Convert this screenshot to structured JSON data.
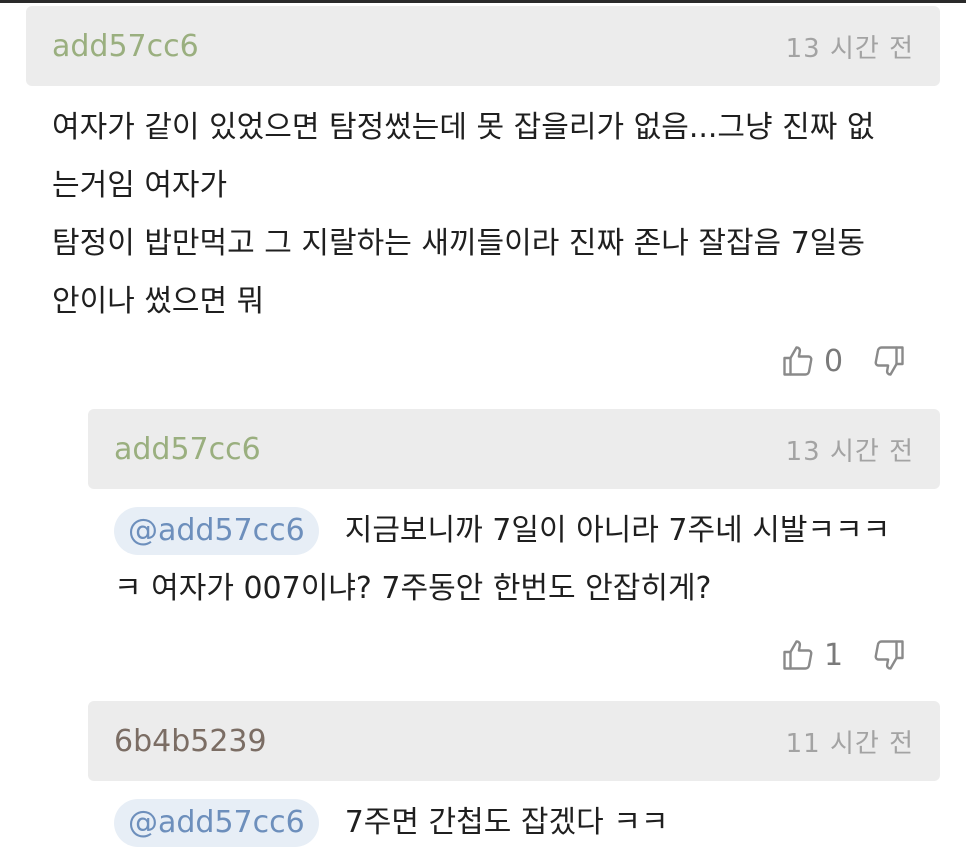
{
  "colors": {
    "author_green": "#9aaf7f",
    "author_brown": "#7b6d64",
    "mention_bg": "#e7eef6",
    "mention_text": "#6d8fbc",
    "header_bg": "#ececec"
  },
  "icons": {
    "like": "thumbs-up-outline",
    "dislike": "thumbs-down-outline"
  },
  "comments": [
    {
      "author": "add57cc6",
      "time": "13 시간 전",
      "lines": [
        "여자가 같이 있었으면 탐정썼는데 못 잡을리가 없음...그냥 진짜 없",
        "는거임 여자가",
        "탐정이 밥만먹고 그 지랄하는 새끼들이라 진짜 존나 잘잡음 7일동",
        "안이나 썼으면 뭐"
      ],
      "likes": "0"
    },
    {
      "author": "add57cc6",
      "time": "13 시간 전",
      "mention": "@add57cc6",
      "line1": "지금보니까 7일이 아니라 7주네 시발ㅋㅋㅋ",
      "line2": "ㅋ 여자가 007이냐? 7주동안 한번도 안잡히게?",
      "likes": "1"
    },
    {
      "author": "6b4b5239",
      "time": "11 시간 전",
      "mention": "@add57cc6",
      "line1": "7주면 간첩도 잡겠다 ㅋㅋ"
    }
  ]
}
